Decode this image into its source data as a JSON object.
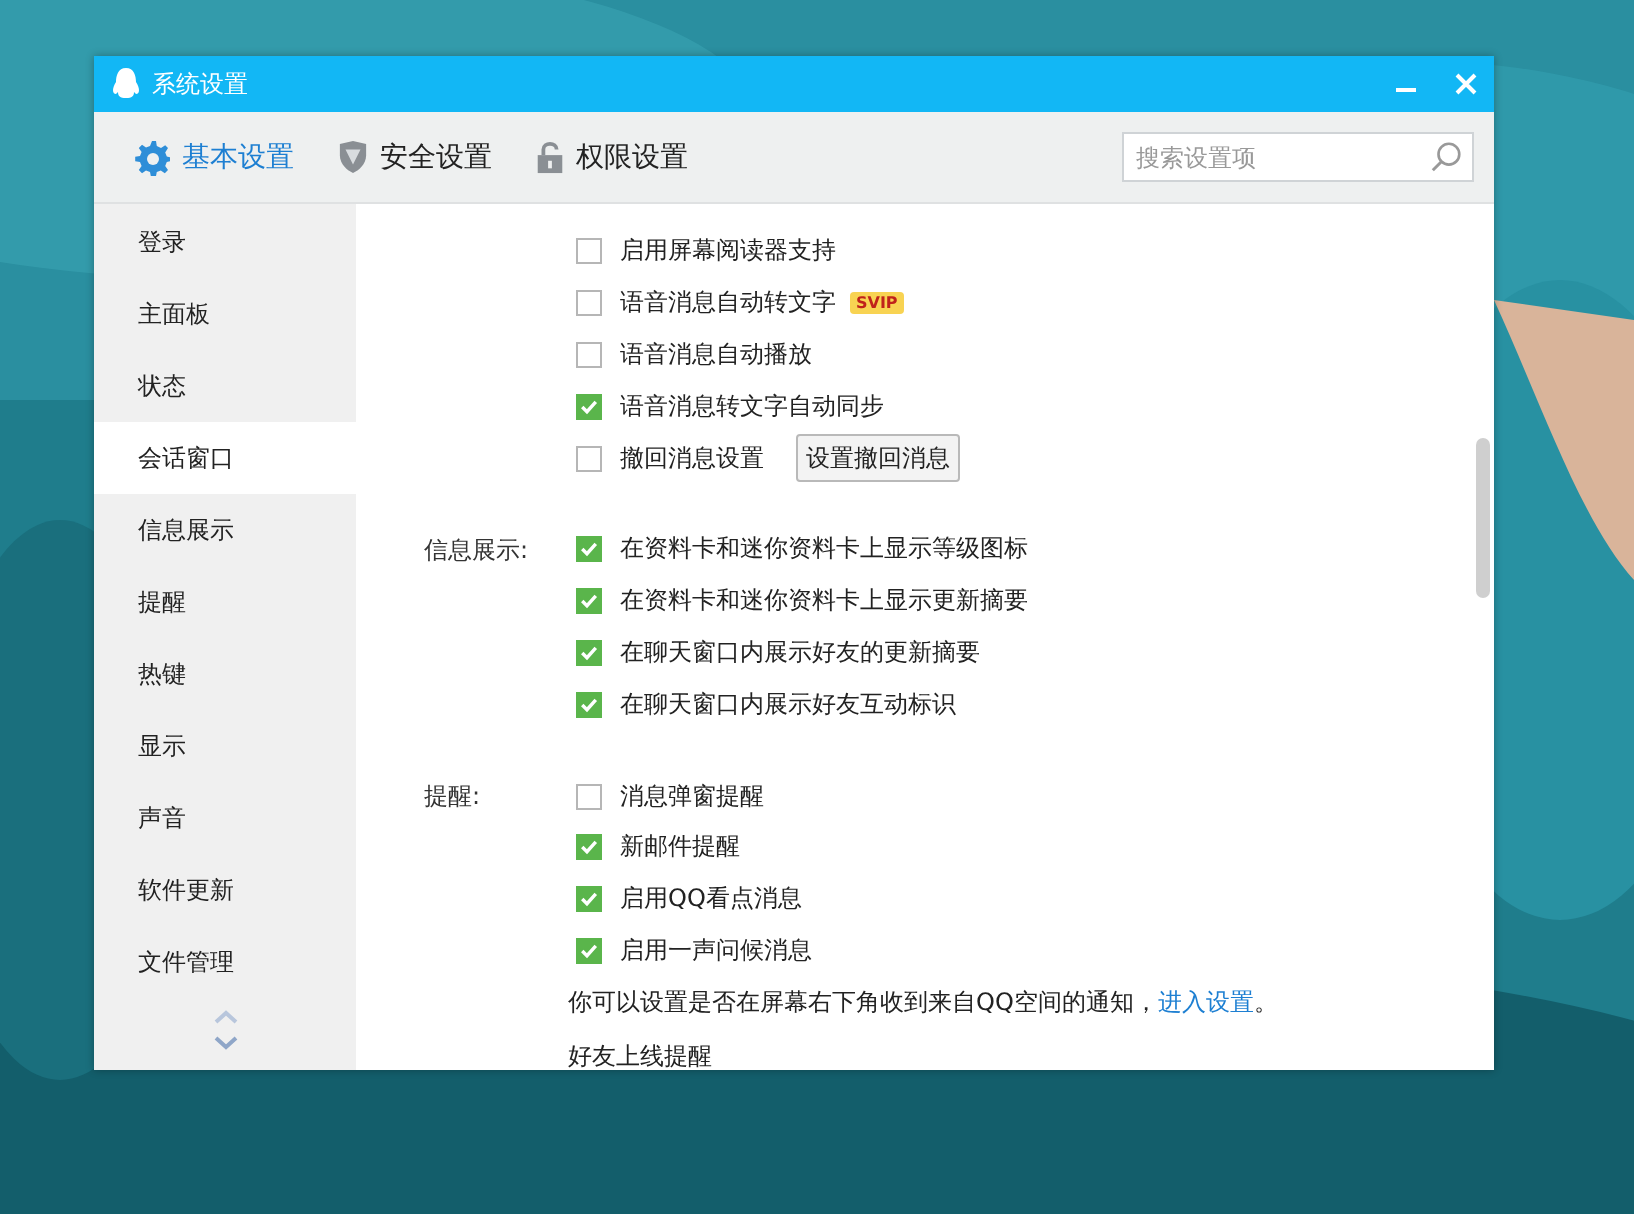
{
  "window": {
    "title": "系统设置"
  },
  "tabs": [
    {
      "label": "基本设置",
      "selected": true
    },
    {
      "label": "安全设置",
      "selected": false
    },
    {
      "label": "权限设置",
      "selected": false
    }
  ],
  "search": {
    "placeholder": "搜索设置项"
  },
  "sidebar": {
    "items": [
      {
        "label": "登录",
        "selected": false
      },
      {
        "label": "主面板",
        "selected": false
      },
      {
        "label": "状态",
        "selected": false
      },
      {
        "label": "会话窗口",
        "selected": true
      },
      {
        "label": "信息展示",
        "selected": false
      },
      {
        "label": "提醒",
        "selected": false
      },
      {
        "label": "热键",
        "selected": false
      },
      {
        "label": "显示",
        "selected": false
      },
      {
        "label": "声音",
        "selected": false
      },
      {
        "label": "软件更新",
        "selected": false
      },
      {
        "label": "文件管理",
        "selected": false
      }
    ]
  },
  "sections": [
    {
      "items": [
        {
          "kind": "checkbox",
          "text": "启用屏幕阅读器支持",
          "checked": false
        },
        {
          "kind": "checkbox",
          "text": "语音消息自动转文字",
          "checked": false,
          "badge": "SVIP"
        },
        {
          "kind": "checkbox",
          "text": "语音消息自动播放",
          "checked": false
        },
        {
          "kind": "checkbox",
          "text": "语音消息转文字自动同步",
          "checked": true
        },
        {
          "kind": "checkbox",
          "text": "撤回消息设置",
          "checked": false,
          "button": "设置撤回消息"
        }
      ]
    },
    {
      "label": "信息展示:",
      "items": [
        {
          "kind": "checkbox",
          "text": "在资料卡和迷你资料卡上显示等级图标",
          "checked": true
        },
        {
          "kind": "checkbox",
          "text": "在资料卡和迷你资料卡上显示更新摘要",
          "checked": true
        },
        {
          "kind": "checkbox",
          "text": "在聊天窗口内展示好友的更新摘要",
          "checked": true
        },
        {
          "kind": "checkbox",
          "text": "在聊天窗口内展示好友互动标识",
          "checked": true
        }
      ]
    },
    {
      "label": "提醒:",
      "items": [
        {
          "kind": "checkbox",
          "text": "消息弹窗提醒",
          "checked": false
        },
        {
          "kind": "checkbox",
          "text": "新邮件提醒",
          "checked": true
        },
        {
          "kind": "checkbox",
          "text": "启用QQ看点消息",
          "checked": true
        },
        {
          "kind": "checkbox",
          "text": "启用一声问候消息",
          "checked": true
        },
        {
          "kind": "note",
          "text": "你可以设置是否在屏幕右下角收到来自QQ空间的通知，",
          "link": "进入设置",
          "end": "。"
        },
        {
          "kind": "subheading",
          "text": "好友上线提醒"
        }
      ]
    }
  ]
}
